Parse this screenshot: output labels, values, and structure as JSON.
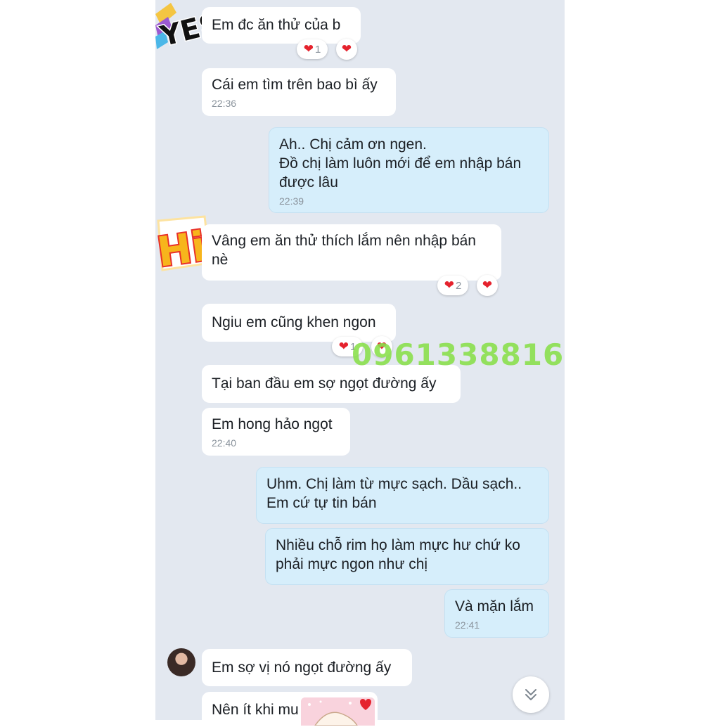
{
  "watermark": "0961338816",
  "messages": [
    {
      "id": "m1",
      "text": "Em đc ăn thử của b",
      "time": ""
    },
    {
      "id": "m2",
      "text": "Cái em tìm trên bao bì ấy",
      "time": "22:36"
    },
    {
      "id": "m3",
      "text": "Ah.. Chị cảm ơn ngen.\nĐồ chị làm luôn mới để em nhập bán được lâu",
      "time": "22:39"
    },
    {
      "id": "m4",
      "text": "Vâng em ăn thử thích lắm nên nhập bán nè",
      "time": ""
    },
    {
      "id": "m5",
      "text": "Ngiu em cũng khen ngon",
      "time": ""
    },
    {
      "id": "m6",
      "text": "Tại ban đầu em sợ ngọt đường ấy",
      "time": ""
    },
    {
      "id": "m7",
      "text": "Em hong hảo ngọt",
      "time": "22:40"
    },
    {
      "id": "m8",
      "text": "Uhm. Chị làm từ mực sạch. Dầu sạch.. Em cứ tự tin bán",
      "time": ""
    },
    {
      "id": "m9",
      "text": "Nhiều chỗ rim họ làm mực hư chứ ko phải mực ngon như chị",
      "time": ""
    },
    {
      "id": "m10",
      "text": "Và mặn lắm",
      "time": "22:41"
    },
    {
      "id": "m11",
      "text": "Em sợ vị nó ngọt đường ấy",
      "time": ""
    },
    {
      "id": "m12",
      "text": "Nên ít khi mu",
      "time": ""
    }
  ],
  "reactions": {
    "r1": {
      "emoji": "❤",
      "count": "1"
    },
    "r2": {
      "emoji": "❤",
      "count": "2"
    },
    "r3": {
      "emoji": "❤",
      "count": "1"
    },
    "heart": "❤"
  },
  "stickers": {
    "yes": "YES",
    "hi": "Hi!"
  },
  "colors": {
    "chat_bg": "#e3e8f0",
    "incoming_bubble": "#ffffff",
    "outgoing_bubble": "#d6eefb",
    "heart": "#e5222d",
    "watermark": "#8be04e"
  },
  "icons": {
    "scroll_down": "double-chevron-down-icon",
    "reaction": "heart-icon"
  }
}
